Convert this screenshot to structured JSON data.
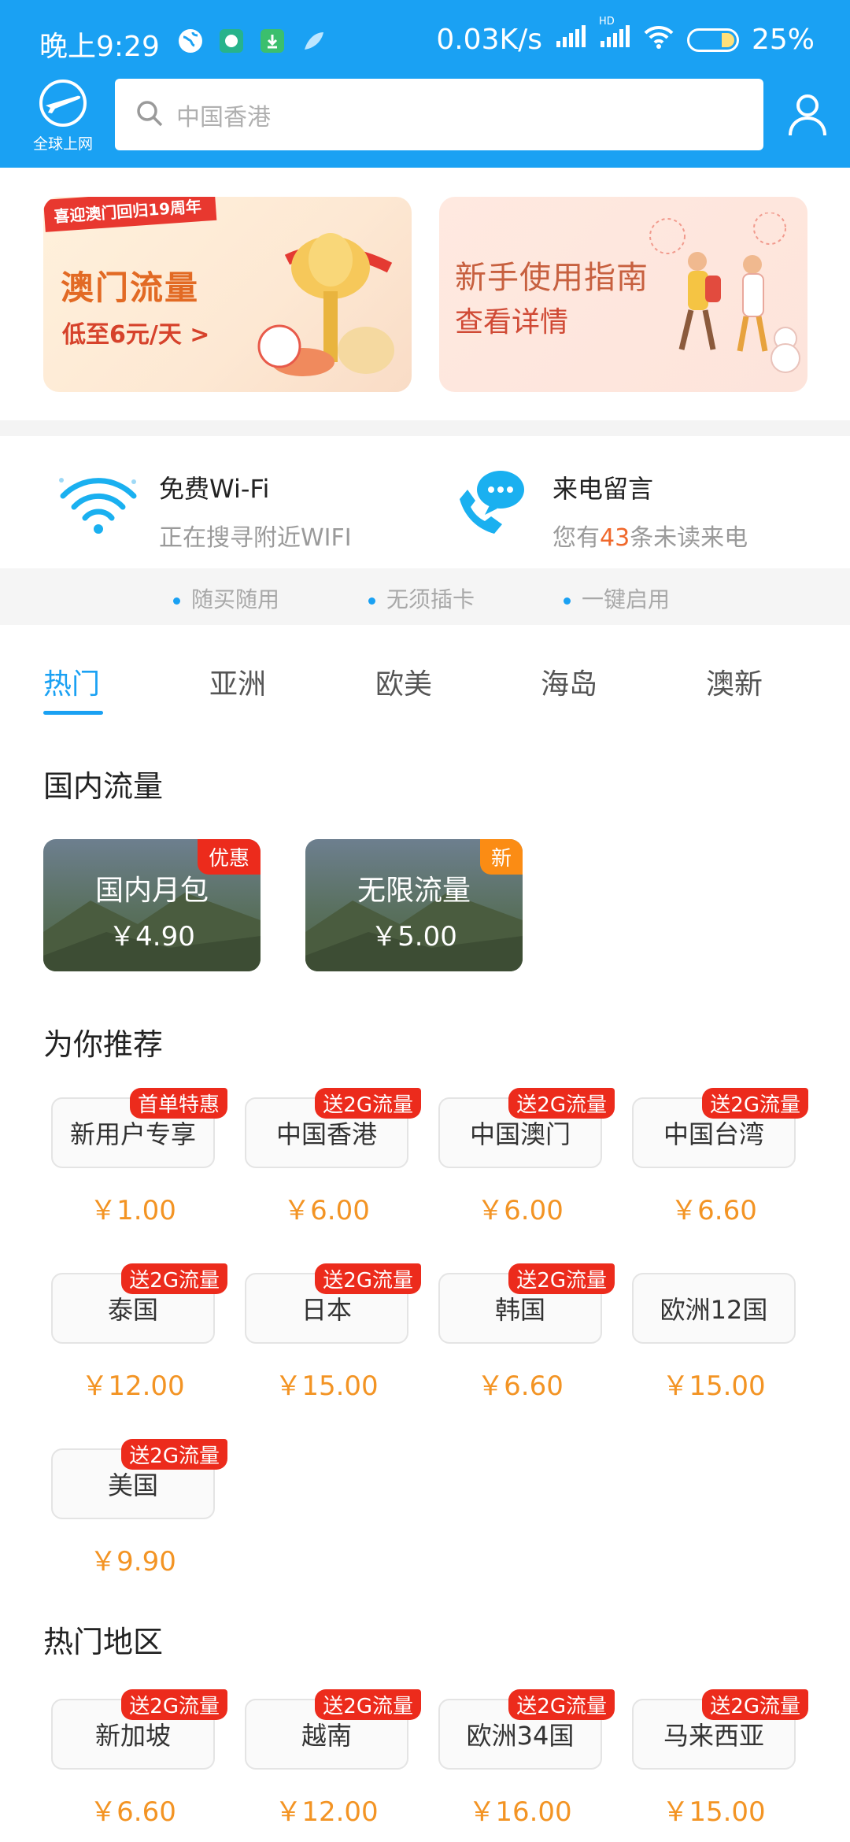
{
  "status": {
    "time": "晚上9:29",
    "speed": "0.03K/s",
    "hd": "HD",
    "battery": "25%"
  },
  "header": {
    "logo_label": "全球上网",
    "search_placeholder": "中国香港"
  },
  "banners": {
    "macau_ribbon": "喜迎澳门回归19周年",
    "macau_title": "澳门流量",
    "macau_sub": "低至6元/天 >",
    "guide_title": "新手使用指南",
    "guide_sub": "查看详情"
  },
  "features": {
    "wifi_title": "免费Wi-Fi",
    "wifi_sub": "正在搜寻附近WIFI",
    "call_title": "来电留言",
    "call_sub_prefix": "您有",
    "call_sub_count": "43",
    "call_sub_suffix": "条未读来电"
  },
  "taglines": [
    "随买随用",
    "无须插卡",
    "一键启用"
  ],
  "tabs": [
    "热门",
    "亚洲",
    "欧美",
    "海岛",
    "澳新"
  ],
  "sections": {
    "domestic": "国内流量",
    "recommend": "为你推荐",
    "hot": "热门地区"
  },
  "domestic": [
    {
      "name": "国内月包",
      "price": "￥4.90",
      "badge": "优惠"
    },
    {
      "name": "无限流量",
      "price": "￥5.00",
      "badge": "新"
    }
  ],
  "recommend": [
    {
      "name": "新用户专享",
      "price": "￥1.00",
      "badge": "首单特惠"
    },
    {
      "name": "中国香港",
      "price": "￥6.00",
      "badge": "送2G流量"
    },
    {
      "name": "中国澳门",
      "price": "￥6.00",
      "badge": "送2G流量"
    },
    {
      "name": "中国台湾",
      "price": "￥6.60",
      "badge": "送2G流量"
    },
    {
      "name": "泰国",
      "price": "￥12.00",
      "badge": "送2G流量"
    },
    {
      "name": "日本",
      "price": "￥15.00",
      "badge": "送2G流量"
    },
    {
      "name": "韩国",
      "price": "￥6.60",
      "badge": "送2G流量"
    },
    {
      "name": "欧洲12国",
      "price": "￥15.00",
      "badge": ""
    },
    {
      "name": "美国",
      "price": "￥9.90",
      "badge": "送2G流量"
    }
  ],
  "hot": [
    {
      "name": "新加坡",
      "price": "￥6.60",
      "badge": "送2G流量"
    },
    {
      "name": "越南",
      "price": "￥12.00",
      "badge": "送2G流量"
    },
    {
      "name": "欧洲34国",
      "price": "￥16.00",
      "badge": "送2G流量"
    },
    {
      "name": "马来西亚",
      "price": "￥15.00",
      "badge": "送2G流量"
    }
  ],
  "colors": {
    "brand_blue": "#1aa1f3",
    "price_orange": "#f39424",
    "badge_red": "#ec2b1c",
    "badge_orange": "#fb8c14"
  }
}
